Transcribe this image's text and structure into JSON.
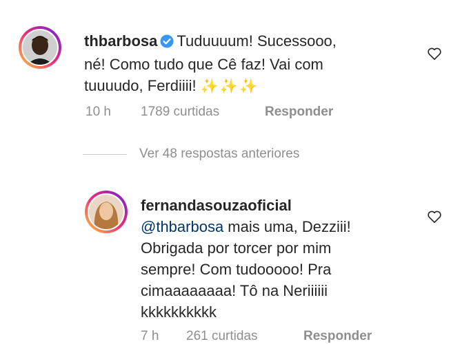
{
  "comments": [
    {
      "username": "thbarbosa",
      "text_lines": [
        "Tuduuuum! Sucessooo,",
        "né! Como tudo que Cê faz! Vai com",
        "tuuuudo, Ferdiiii!"
      ],
      "sparkles": "✨✨✨",
      "time": "10 h",
      "likes": "1789 curtidas",
      "reply_label": "Responder"
    },
    {
      "username": "fernandasouzaoficial",
      "mention": "@thbarbosa",
      "text_first": " mais uma, Dezziii!",
      "text_lines": [
        "Obrigada por torcer por mim",
        "sempre! Com tudooooo! Pra",
        "cimaaaaaaaa! Tô na Neriiiiii",
        "kkkkkkkkkk"
      ],
      "time": "7 h",
      "likes": "261 curtidas",
      "reply_label": "Responder"
    }
  ],
  "view_previous": "Ver 48 respostas anteriores",
  "colors": {
    "muted": "#8e8e8e",
    "mention": "#00376b",
    "verified": "#3897f0"
  },
  "icons": [
    "heart-icon",
    "verified-badge-icon"
  ]
}
